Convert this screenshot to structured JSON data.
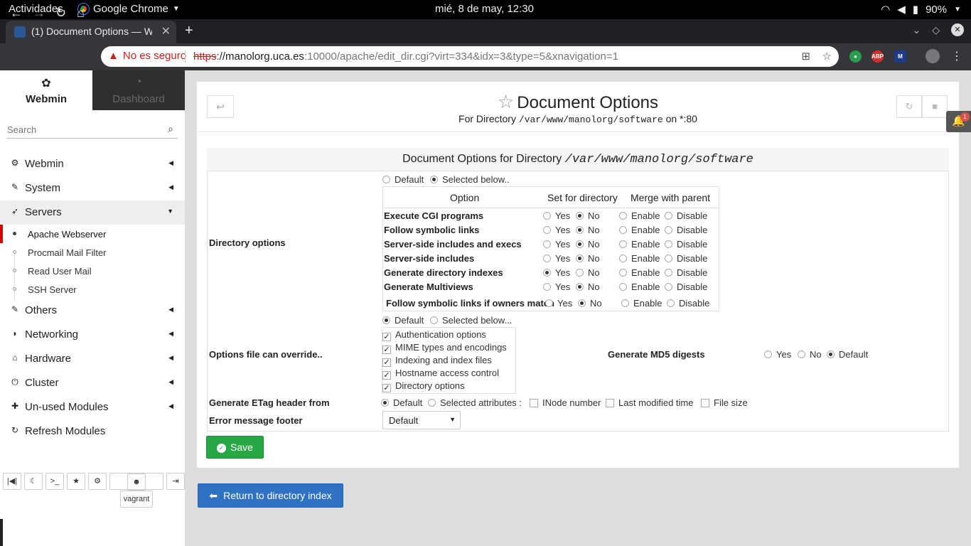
{
  "topbar": {
    "activities": "Actividades",
    "app_name": "Google Chrome",
    "clock": "mié,  8 de may, 12:30",
    "battery": "90%"
  },
  "browser": {
    "tab_title": "(1) Document Options — W",
    "insecure_label": "No es seguro",
    "url_scheme": "https",
    "url_host": "://manolorg.uca.es",
    "url_rest": ":10000/apache/edit_dir.cgi?virt=334&idx=3&type=5&xnavigation=1"
  },
  "sidebar": {
    "tab_webmin": "Webmin",
    "tab_dashboard": "Dashboard",
    "search_placeholder": "Search",
    "menu": [
      {
        "label": "Webmin",
        "icon": "gear-icon"
      },
      {
        "label": "System",
        "icon": "wrench-icon"
      },
      {
        "label": "Servers",
        "icon": "rocket-icon"
      },
      {
        "label": "Others",
        "icon": "wrench-icon"
      },
      {
        "label": "Networking",
        "icon": "shield-icon"
      },
      {
        "label": "Hardware",
        "icon": "drive-icon"
      },
      {
        "label": "Cluster",
        "icon": "power-icon"
      },
      {
        "label": "Un-used Modules",
        "icon": "puzzle-icon"
      },
      {
        "label": "Refresh Modules",
        "icon": "refresh-icon"
      }
    ],
    "servers_items": [
      "Apache Webserver",
      "Procmail Mail Filter",
      "Read User Mail",
      "SSH Server"
    ],
    "user": "vagrant"
  },
  "page": {
    "title": "Document Options",
    "subtitle_prefix": "For Directory",
    "subtitle_path": "/var/www/manolorg/software",
    "subtitle_suffix": "on *:80",
    "panel_title": "Document Options for Directory",
    "panel_path": "/var/www/manolorg/software"
  },
  "form": {
    "directory_options_label": "Directory options",
    "mode_default": "Default",
    "mode_selected": "Selected below..",
    "col_option": "Option",
    "col_set": "Set for directory",
    "col_merge": "Merge with parent",
    "yes": "Yes",
    "no": "No",
    "enable": "Enable",
    "disable": "Disable",
    "options": [
      {
        "name": "Execute CGI programs",
        "set": "No"
      },
      {
        "name": "Follow symbolic links",
        "set": "No"
      },
      {
        "name": "Server-side includes and execs",
        "set": "No"
      },
      {
        "name": "Server-side includes",
        "set": "No"
      },
      {
        "name": "Generate directory indexes",
        "set": "Yes"
      },
      {
        "name": "Generate Multiviews",
        "set": "No"
      },
      {
        "name": "Follow symbolic links if owners match",
        "set": "No"
      }
    ],
    "override_label": "Options file can override..",
    "override_default": "Default",
    "override_selected": "Selected below...",
    "override_items": [
      "Authentication options",
      "MIME types and encodings",
      "Indexing and index files",
      "Hostname access control",
      "Directory options"
    ],
    "md5_label": "Generate MD5 digests",
    "md5_options": [
      "Yes",
      "No",
      "Default"
    ],
    "md5_selected": "Default",
    "etag_label": "Generate ETag header from",
    "etag_default": "Default",
    "etag_selected_attrs": "Selected attributes :",
    "etag_attrs": [
      "INode number",
      "Last modified time",
      "File size"
    ],
    "footer_label": "Error message footer",
    "footer_value": "Default",
    "save_label": "Save",
    "return_label": "Return to directory index"
  }
}
